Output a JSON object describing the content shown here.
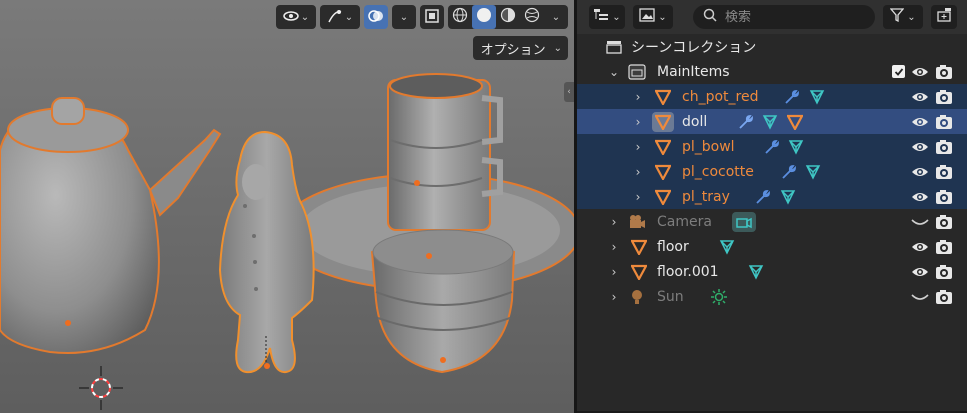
{
  "viewport": {
    "options_label": "オプション",
    "header_icons": [
      "viewport-gizmo-icon",
      "transform-icon",
      "overlays-icon",
      "xray-icon",
      "wireframe-icon",
      "solid-icon",
      "material-icon",
      "rendered-icon"
    ]
  },
  "outliner": {
    "search_placeholder": "検索",
    "root_label": "シーンコレクション",
    "colors": {
      "selected_row": "#1f3451",
      "active_row": "#334d80",
      "object_orange": "#ef8a3c",
      "modifier_blue": "#5b8fe0",
      "mesh_teal": "#3fc6c4"
    },
    "rows": [
      {
        "label": "MainItems",
        "kind": "collection"
      },
      {
        "label": "ch_pot_red",
        "kind": "mesh",
        "state": "selected",
        "icons": [
          "wrench-icon",
          "mesh-data-icon"
        ]
      },
      {
        "label": "doll",
        "kind": "mesh",
        "state": "active",
        "icons": [
          "wrench-icon",
          "mesh-data-icon",
          "mesh-object-icon"
        ]
      },
      {
        "label": "pl_bowl",
        "kind": "mesh",
        "state": "selected",
        "icons": [
          "wrench-icon",
          "mesh-data-icon"
        ]
      },
      {
        "label": "pl_cocotte",
        "kind": "mesh",
        "state": "selected",
        "icons": [
          "wrench-icon",
          "mesh-data-icon"
        ]
      },
      {
        "label": "pl_tray",
        "kind": "mesh",
        "state": "selected",
        "icons": [
          "wrench-icon",
          "mesh-data-icon"
        ]
      },
      {
        "label": "Camera",
        "kind": "camera",
        "state": "hidden",
        "icons": [
          "camera-data-icon"
        ]
      },
      {
        "label": "floor",
        "kind": "mesh",
        "state": "normal",
        "icons": [
          "mesh-data-icon"
        ]
      },
      {
        "label": "floor.001",
        "kind": "mesh",
        "state": "normal",
        "icons": [
          "mesh-data-icon"
        ]
      },
      {
        "label": "Sun",
        "kind": "light",
        "state": "hidden",
        "icons": [
          "sun-data-icon"
        ]
      }
    ]
  }
}
